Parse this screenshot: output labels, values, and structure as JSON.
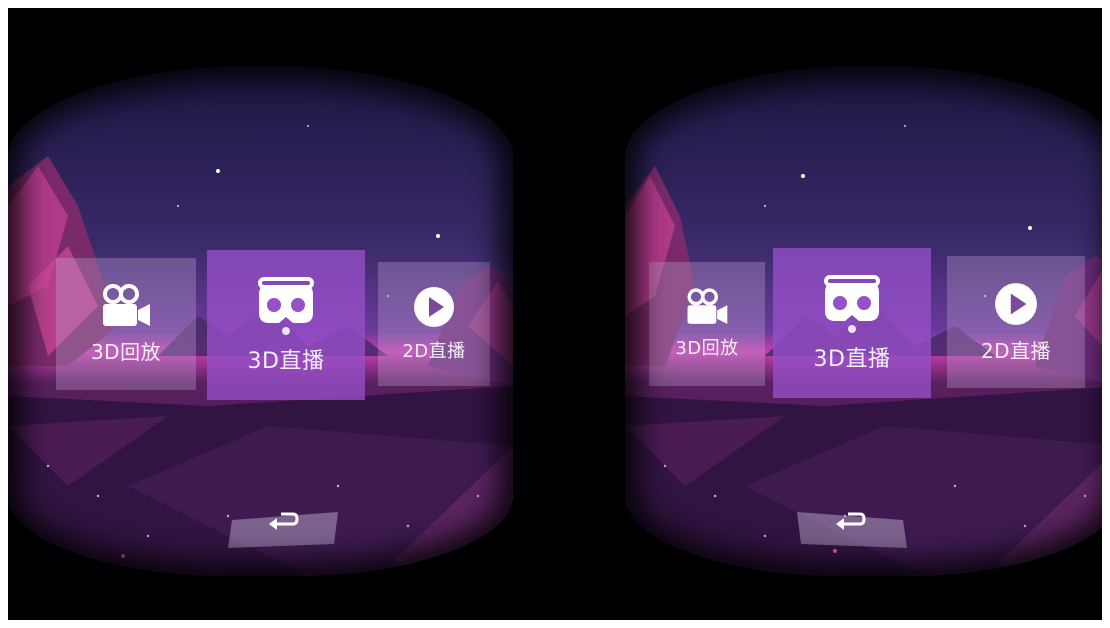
{
  "menu": {
    "items": [
      {
        "label": "3D回放",
        "icon": "video-camera-icon"
      },
      {
        "label": "3D直播",
        "icon": "vr-headset-icon"
      },
      {
        "label": "2D直播",
        "icon": "play-circle-icon"
      }
    ],
    "selected": "3D直播"
  },
  "back": {
    "icon": "return-arrow-icon"
  },
  "colors": {
    "sky_top": "#1f1a4a",
    "sky_mid": "#4a2d7a",
    "horizon": "#c23fb0",
    "ground": "#3a1a4a",
    "selected_tile": "#9650c8",
    "side_tile": "#c3aad2"
  }
}
